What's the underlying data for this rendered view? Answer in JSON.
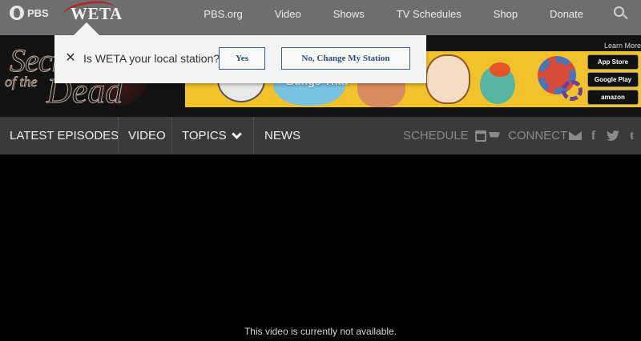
{
  "topbar": {
    "pbs_logo": "PBS",
    "station_logo": "WETA",
    "nav": [
      "PBS.org",
      "Video",
      "Shows",
      "TV Schedules",
      "Shop",
      "Donate"
    ]
  },
  "banner": {
    "show_logo_line1": "Secrets",
    "show_logo_line2": "of the",
    "show_logo_line3": "Dead",
    "learn_more": "Learn More",
    "ad_title": "Bungs That",
    "stores": [
      "App Store",
      "Google Play",
      "amazon"
    ]
  },
  "popup": {
    "question": "Is WETA your local station?",
    "yes_label": "Yes",
    "change_label": "No, Change My Station"
  },
  "subnav": {
    "items": [
      "LATEST EPISODES",
      "VIDEO",
      "TOPICS",
      "NEWS"
    ],
    "schedule": "SCHEDULE",
    "connect": "CONNECT",
    "social": {
      "facebook": "f",
      "tumblr": "t"
    }
  },
  "video": {
    "message": "This video is currently not available."
  },
  "colors": {
    "topbar_bg": "#6e6e6e",
    "subnav_bg": "#3a3a3a",
    "popup_button": "#2c4e78",
    "weta_red": "#b3262b",
    "ad_yellow": "#f2c22a"
  }
}
